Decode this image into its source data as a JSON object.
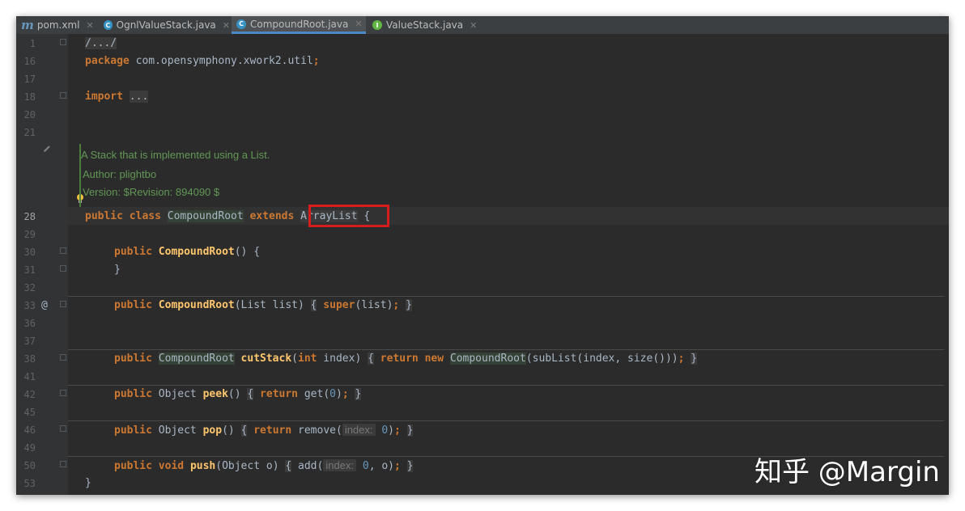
{
  "tabs": [
    {
      "label": "pom.xml",
      "icon": "maven-icon",
      "active": false
    },
    {
      "label": "OgnlValueStack.java",
      "icon": "class-icon",
      "active": false
    },
    {
      "label": "CompoundRoot.java",
      "icon": "class-icon",
      "active": true
    },
    {
      "label": "ValueStack.java",
      "icon": "interface-icon",
      "active": false
    }
  ],
  "line_numbers": [
    "1",
    "16",
    "17",
    "18",
    "20",
    "21",
    "28",
    "29",
    "30",
    "31",
    "32",
    "33",
    "36",
    "37",
    "38",
    "41",
    "42",
    "45",
    "46",
    "49",
    "50",
    "53"
  ],
  "code": {
    "l1": "/.../",
    "l16_kw": "package",
    "l16_rest": " com.opensymphony.xwork2.util",
    "l16_semi": ";",
    "l18_kw": "import",
    "l18_fold": "...",
    "doc": {
      "line1": "A Stack that is implemented using a List.",
      "line2": "Author:  plightbo",
      "line3": "Version: $Revision: 894090 $"
    },
    "l28_kw1": "public",
    "l28_kw2": "class",
    "l28_name": "CompoundRoot",
    "l28_kw3": "extends",
    "l28_super": "ArrayList",
    "l28_brace": "{",
    "l30_kw": "public",
    "l30_name": "CompoundRoot",
    "l30_rest": "() {",
    "l31": "}",
    "l33_kw": "public",
    "l33_name": "CompoundRoot",
    "l33_params": "(List list)",
    "l33_open": "{",
    "l33_super": "super",
    "l33_args": "(list)",
    "l33_semi": ";",
    "l33_close": "}",
    "l38_kw": "public",
    "l38_type": "CompoundRoot",
    "l38_name": "cutStack",
    "l38_params1": "(",
    "l38_int": "int",
    "l38_params2": " index)",
    "l38_open": "{",
    "l38_ret": "return",
    "l38_new": "new",
    "l38_ctor": "CompoundRoot",
    "l38_args": "(subList(index, size()))",
    "l38_semi": ";",
    "l38_close": "}",
    "l42_kw": "public",
    "l42_type": "Object",
    "l42_name": "peek",
    "l42_params": "()",
    "l42_open": "{",
    "l42_ret": "return",
    "l42_call": "get(",
    "l42_num": "0",
    "l42_end": ")",
    "l42_semi": ";",
    "l42_close": "}",
    "l46_kw": "public",
    "l46_type": "Object",
    "l46_name": "pop",
    "l46_params": "()",
    "l46_open": "{",
    "l46_ret": "return",
    "l46_call": "remove(",
    "l46_hint": "index:",
    "l46_num": "0",
    "l46_end": ")",
    "l46_semi": ";",
    "l46_close": "}",
    "l50_kw": "public",
    "l50_void": "void",
    "l50_name": "push",
    "l50_params": "(Object o)",
    "l50_open": "{",
    "l50_call": "add(",
    "l50_hint": "index:",
    "l50_num": "0",
    "l50_rest": ", o)",
    "l50_semi": ";",
    "l50_close": "}",
    "l53": "}"
  },
  "watermark": "知乎 @Margin",
  "colors": {
    "background": "#2b2b2b",
    "keyword": "#cc7832",
    "method": "#ffc66d",
    "number": "#6897bb",
    "doc_comment": "#629755",
    "highlight_box": "#d61c1c"
  }
}
